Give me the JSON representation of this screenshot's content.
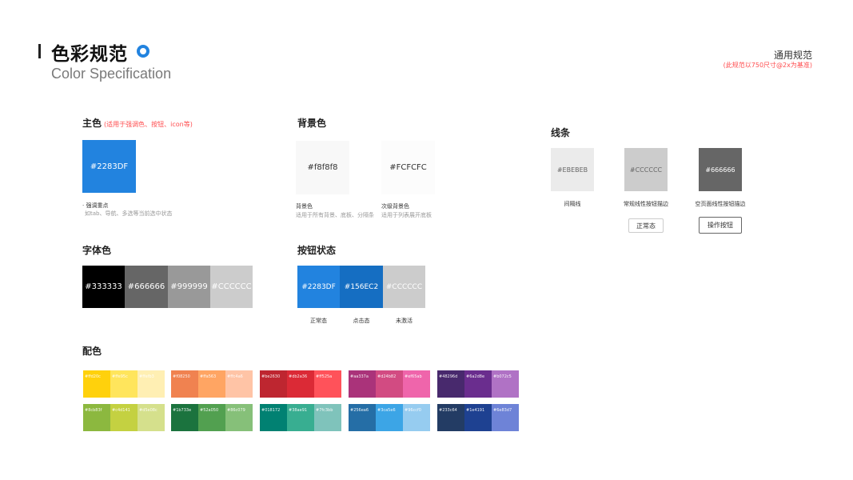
{
  "header": {
    "title": "色彩规范",
    "subtitle": "Color Specification",
    "right_title": "通用规范",
    "right_note": "(此规范以750尺寸@2x为基准)"
  },
  "primary": {
    "heading": "主色",
    "heading_note": "(适用于强调色、按钮、icon等)",
    "swatch": {
      "label": "#2283DF",
      "color": "#2283DF"
    },
    "caption1": "· 强调重点",
    "caption2": "如tab、导航、多选等当前选中状态"
  },
  "background": {
    "heading": "背景色",
    "swatches": [
      {
        "label": "#f8f8f8",
        "color": "#f8f8f8",
        "caption1": "背景色",
        "caption2": "适用于所有背景、底板、分隔条"
      },
      {
        "label": "#FCFCFC",
        "color": "#FCFCFC",
        "caption1": "次级背景色",
        "caption2": "适用于列表展开底板"
      }
    ]
  },
  "lines": {
    "heading": "线条",
    "swatches": [
      {
        "label": "#EBEBEB",
        "color": "#EBEBEB",
        "text_color": "#666666",
        "caption": "间隔线"
      },
      {
        "label": "#CCCCCC",
        "color": "#CCCCCC",
        "text_color": "#666666",
        "caption": "常规线性按钮描边",
        "button": "正常态"
      },
      {
        "label": "#666666",
        "color": "#666666",
        "text_color": "#ffffff",
        "caption": "空页面线性按钮描边",
        "button": "操作按钮"
      }
    ]
  },
  "font_colors": {
    "heading": "字体色",
    "swatches": [
      {
        "label": "#333333",
        "color": "#000000"
      },
      {
        "label": "#666666",
        "color": "#666666"
      },
      {
        "label": "#999999",
        "color": "#999999"
      },
      {
        "label": "#CCCCCC",
        "color": "#CCCCCC"
      }
    ]
  },
  "button_states": {
    "heading": "按钮状态",
    "swatches": [
      {
        "label": "#2283DF",
        "color": "#2283DF",
        "caption": "正常态"
      },
      {
        "label": "#156EC2",
        "color": "#156EC2",
        "caption": "点击态"
      },
      {
        "label": "#CCCCCC",
        "color": "#CCCCCC",
        "caption": "未激活"
      }
    ]
  },
  "palette": {
    "heading": "配色",
    "groups": [
      {
        "rows": [
          [
            {
              "label": "#ffd20c",
              "color": "#FFD10C"
            },
            {
              "label": "#ffe95c",
              "color": "#FFE55C"
            },
            {
              "label": "#ffefb3",
              "color": "#FFEFB3"
            }
          ],
          [
            {
              "label": "#8cb83f",
              "color": "#8CB83F"
            },
            {
              "label": "#c4d141",
              "color": "#C4D141"
            },
            {
              "label": "#d5e08c",
              "color": "#D5E08C"
            }
          ]
        ]
      },
      {
        "rows": [
          [
            {
              "label": "#f08250",
              "color": "#F08250"
            },
            {
              "label": "#ffa563",
              "color": "#FFA563"
            },
            {
              "label": "#ffc4a6",
              "color": "#FFC4A6"
            }
          ],
          [
            {
              "label": "#1b733e",
              "color": "#1B733E"
            },
            {
              "label": "#52a050",
              "color": "#52A050"
            },
            {
              "label": "#86c079",
              "color": "#86C079"
            }
          ]
        ]
      },
      {
        "rows": [
          [
            {
              "label": "#be2630",
              "color": "#BE2630"
            },
            {
              "label": "#db2a36",
              "color": "#DB2A36"
            },
            {
              "label": "#ff525a",
              "color": "#FF525A"
            }
          ],
          [
            {
              "label": "#018172",
              "color": "#018172"
            },
            {
              "label": "#38ae91",
              "color": "#38AE91"
            },
            {
              "label": "#7fc3bb",
              "color": "#7FC3BB"
            }
          ]
        ]
      },
      {
        "rows": [
          [
            {
              "label": "#aa337a",
              "color": "#AA337A"
            },
            {
              "label": "#d24b82",
              "color": "#D24B82"
            },
            {
              "label": "#ef65ab",
              "color": "#EF65AB"
            }
          ],
          [
            {
              "label": "#256ea6",
              "color": "#256EA6"
            },
            {
              "label": "#3ca5e6",
              "color": "#3CA5E6"
            },
            {
              "label": "#96ccf0",
              "color": "#96CCF0"
            }
          ]
        ]
      },
      {
        "rows": [
          [
            {
              "label": "#48296d",
              "color": "#48296D"
            },
            {
              "label": "#6a2d8e",
              "color": "#6A2D8E"
            },
            {
              "label": "#b072c5",
              "color": "#B072C5"
            }
          ],
          [
            {
              "label": "#233c64",
              "color": "#233C64"
            },
            {
              "label": "#1e4191",
              "color": "#1E4191"
            },
            {
              "label": "#6e83d7",
              "color": "#6E83D7"
            }
          ]
        ]
      }
    ]
  }
}
